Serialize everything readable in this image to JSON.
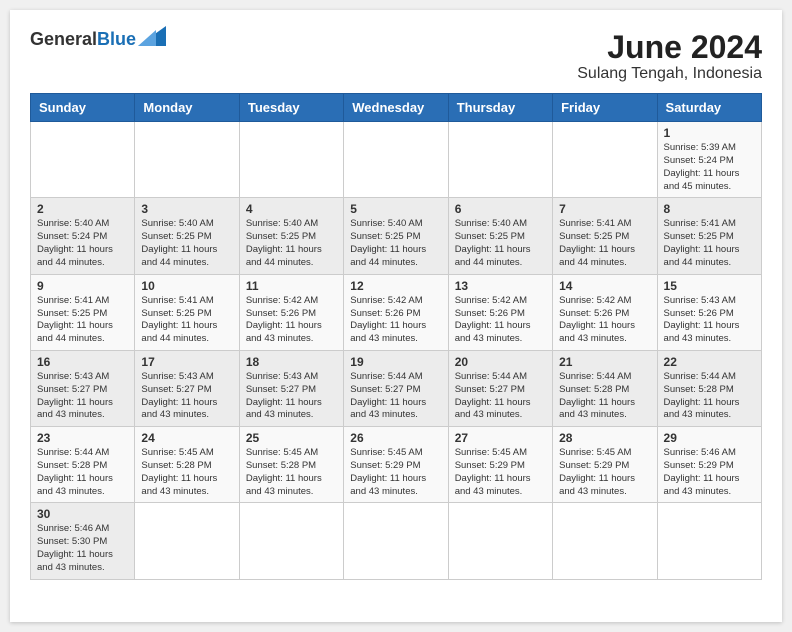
{
  "header": {
    "logo_line1": "General",
    "logo_line2": "Blue",
    "month_year": "June 2024",
    "location": "Sulang Tengah, Indonesia"
  },
  "weekdays": [
    "Sunday",
    "Monday",
    "Tuesday",
    "Wednesday",
    "Thursday",
    "Friday",
    "Saturday"
  ],
  "weeks": [
    [
      {
        "day": "",
        "info": ""
      },
      {
        "day": "",
        "info": ""
      },
      {
        "day": "",
        "info": ""
      },
      {
        "day": "",
        "info": ""
      },
      {
        "day": "",
        "info": ""
      },
      {
        "day": "",
        "info": ""
      },
      {
        "day": "1",
        "info": "Sunrise: 5:39 AM\nSunset: 5:24 PM\nDaylight: 11 hours\nand 45 minutes."
      }
    ],
    [
      {
        "day": "2",
        "info": "Sunrise: 5:40 AM\nSunset: 5:24 PM\nDaylight: 11 hours\nand 44 minutes."
      },
      {
        "day": "3",
        "info": "Sunrise: 5:40 AM\nSunset: 5:25 PM\nDaylight: 11 hours\nand 44 minutes."
      },
      {
        "day": "4",
        "info": "Sunrise: 5:40 AM\nSunset: 5:25 PM\nDaylight: 11 hours\nand 44 minutes."
      },
      {
        "day": "5",
        "info": "Sunrise: 5:40 AM\nSunset: 5:25 PM\nDaylight: 11 hours\nand 44 minutes."
      },
      {
        "day": "6",
        "info": "Sunrise: 5:40 AM\nSunset: 5:25 PM\nDaylight: 11 hours\nand 44 minutes."
      },
      {
        "day": "7",
        "info": "Sunrise: 5:41 AM\nSunset: 5:25 PM\nDaylight: 11 hours\nand 44 minutes."
      },
      {
        "day": "8",
        "info": "Sunrise: 5:41 AM\nSunset: 5:25 PM\nDaylight: 11 hours\nand 44 minutes."
      }
    ],
    [
      {
        "day": "9",
        "info": "Sunrise: 5:41 AM\nSunset: 5:25 PM\nDaylight: 11 hours\nand 44 minutes."
      },
      {
        "day": "10",
        "info": "Sunrise: 5:41 AM\nSunset: 5:25 PM\nDaylight: 11 hours\nand 44 minutes."
      },
      {
        "day": "11",
        "info": "Sunrise: 5:42 AM\nSunset: 5:26 PM\nDaylight: 11 hours\nand 43 minutes."
      },
      {
        "day": "12",
        "info": "Sunrise: 5:42 AM\nSunset: 5:26 PM\nDaylight: 11 hours\nand 43 minutes."
      },
      {
        "day": "13",
        "info": "Sunrise: 5:42 AM\nSunset: 5:26 PM\nDaylight: 11 hours\nand 43 minutes."
      },
      {
        "day": "14",
        "info": "Sunrise: 5:42 AM\nSunset: 5:26 PM\nDaylight: 11 hours\nand 43 minutes."
      },
      {
        "day": "15",
        "info": "Sunrise: 5:43 AM\nSunset: 5:26 PM\nDaylight: 11 hours\nand 43 minutes."
      }
    ],
    [
      {
        "day": "16",
        "info": "Sunrise: 5:43 AM\nSunset: 5:27 PM\nDaylight: 11 hours\nand 43 minutes."
      },
      {
        "day": "17",
        "info": "Sunrise: 5:43 AM\nSunset: 5:27 PM\nDaylight: 11 hours\nand 43 minutes."
      },
      {
        "day": "18",
        "info": "Sunrise: 5:43 AM\nSunset: 5:27 PM\nDaylight: 11 hours\nand 43 minutes."
      },
      {
        "day": "19",
        "info": "Sunrise: 5:44 AM\nSunset: 5:27 PM\nDaylight: 11 hours\nand 43 minutes."
      },
      {
        "day": "20",
        "info": "Sunrise: 5:44 AM\nSunset: 5:27 PM\nDaylight: 11 hours\nand 43 minutes."
      },
      {
        "day": "21",
        "info": "Sunrise: 5:44 AM\nSunset: 5:28 PM\nDaylight: 11 hours\nand 43 minutes."
      },
      {
        "day": "22",
        "info": "Sunrise: 5:44 AM\nSunset: 5:28 PM\nDaylight: 11 hours\nand 43 minutes."
      }
    ],
    [
      {
        "day": "23",
        "info": "Sunrise: 5:44 AM\nSunset: 5:28 PM\nDaylight: 11 hours\nand 43 minutes."
      },
      {
        "day": "24",
        "info": "Sunrise: 5:45 AM\nSunset: 5:28 PM\nDaylight: 11 hours\nand 43 minutes."
      },
      {
        "day": "25",
        "info": "Sunrise: 5:45 AM\nSunset: 5:28 PM\nDaylight: 11 hours\nand 43 minutes."
      },
      {
        "day": "26",
        "info": "Sunrise: 5:45 AM\nSunset: 5:29 PM\nDaylight: 11 hours\nand 43 minutes."
      },
      {
        "day": "27",
        "info": "Sunrise: 5:45 AM\nSunset: 5:29 PM\nDaylight: 11 hours\nand 43 minutes."
      },
      {
        "day": "28",
        "info": "Sunrise: 5:45 AM\nSunset: 5:29 PM\nDaylight: 11 hours\nand 43 minutes."
      },
      {
        "day": "29",
        "info": "Sunrise: 5:46 AM\nSunset: 5:29 PM\nDaylight: 11 hours\nand 43 minutes."
      }
    ],
    [
      {
        "day": "30",
        "info": "Sunrise: 5:46 AM\nSunset: 5:30 PM\nDaylight: 11 hours\nand 43 minutes."
      },
      {
        "day": "",
        "info": ""
      },
      {
        "day": "",
        "info": ""
      },
      {
        "day": "",
        "info": ""
      },
      {
        "day": "",
        "info": ""
      },
      {
        "day": "",
        "info": ""
      },
      {
        "day": "",
        "info": ""
      }
    ]
  ]
}
